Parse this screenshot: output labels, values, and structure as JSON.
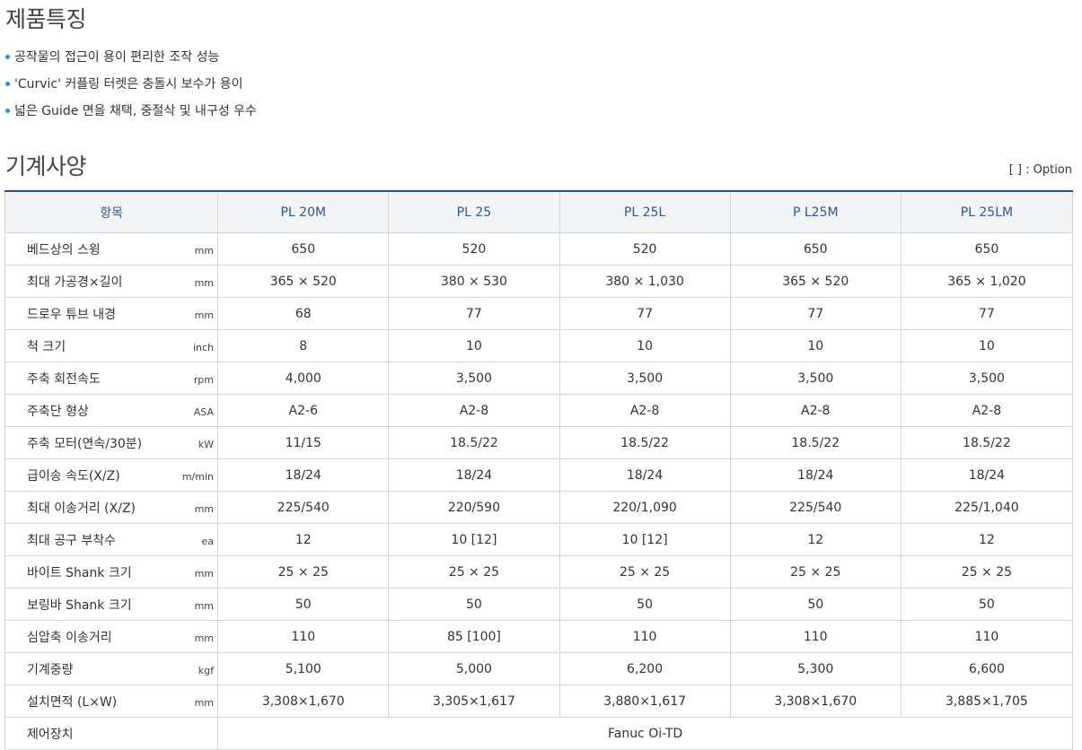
{
  "headings": {
    "features": "제품특징",
    "specs": "기계사양"
  },
  "features": [
    "공작물의 접근이 용이 편리한 조작 성능",
    "'Curvic' 커플링 터렛은 충돌시 보수가 용이",
    "넓은 Guide 면을 채택, 중절삭 및 내구성 우수"
  ],
  "option_note": "[ ] : Option",
  "table": {
    "item_header": "항목",
    "models": [
      "PL 20M",
      "PL 25",
      "PL 25L",
      "P L25M",
      "PL 25LM"
    ],
    "rows": [
      {
        "label": "베드상의 스윙",
        "unit": "mm",
        "values": [
          "650",
          "520",
          "520",
          "650",
          "650"
        ]
      },
      {
        "label": "최대 가공경×길이",
        "unit": "mm",
        "values": [
          "365 × 520",
          "380 × 530",
          "380 × 1,030",
          "365 × 520",
          "365 × 1,020"
        ]
      },
      {
        "label": "드로우 튜브 내경",
        "unit": "mm",
        "values": [
          "68",
          "77",
          "77",
          "77",
          "77"
        ]
      },
      {
        "label": "척 크기",
        "unit": "inch",
        "values": [
          "8",
          "10",
          "10",
          "10",
          "10"
        ]
      },
      {
        "label": "주축 회전속도",
        "unit": "rpm",
        "values": [
          "4,000",
          "3,500",
          "3,500",
          "3,500",
          "3,500"
        ]
      },
      {
        "label": "주축단 형상",
        "unit": "ASA",
        "values": [
          "A2-6",
          "A2-8",
          "A2-8",
          "A2-8",
          "A2-8"
        ]
      },
      {
        "label": "주축 모터(연속/30분)",
        "unit": "kW",
        "values": [
          "11/15",
          "18.5/22",
          "18.5/22",
          "18.5/22",
          "18.5/22"
        ]
      },
      {
        "label": "급이송 속도(X/Z)",
        "unit": "m/min",
        "values": [
          "18/24",
          "18/24",
          "18/24",
          "18/24",
          "18/24"
        ]
      },
      {
        "label": "최대 이송거리 (X/Z)",
        "unit": "mm",
        "values": [
          "225/540",
          "220/590",
          "220/1,090",
          "225/540",
          "225/1,040"
        ]
      },
      {
        "label": "최대 공구 부착수",
        "unit": "ea",
        "values": [
          "12",
          "10 [12]",
          "10 [12]",
          "12",
          "12"
        ]
      },
      {
        "label": "바이트 Shank 크기",
        "unit": "mm",
        "values": [
          "25 × 25",
          "25 × 25",
          "25 × 25",
          "25 × 25",
          "25 × 25"
        ]
      },
      {
        "label": "보링바 Shank 크기",
        "unit": "mm",
        "values": [
          "50",
          "50",
          "50",
          "50",
          "50"
        ]
      },
      {
        "label": "심압축 이송거리",
        "unit": "mm",
        "values": [
          "110",
          "85 [100]",
          "110",
          "110",
          "110"
        ]
      },
      {
        "label": "기계중량",
        "unit": "kgf",
        "values": [
          "5,100",
          "5,000",
          "6,200",
          "5,300",
          "6,600"
        ]
      },
      {
        "label": "설치면적 (L×W)",
        "unit": "mm",
        "values": [
          "3,308×1,670",
          "3,305×1,617",
          "3,880×1,617",
          "3,308×1,670",
          "3,885×1,705"
        ]
      }
    ],
    "control": {
      "label": "제어장치",
      "value": "Fanuc Oi-TD"
    }
  }
}
